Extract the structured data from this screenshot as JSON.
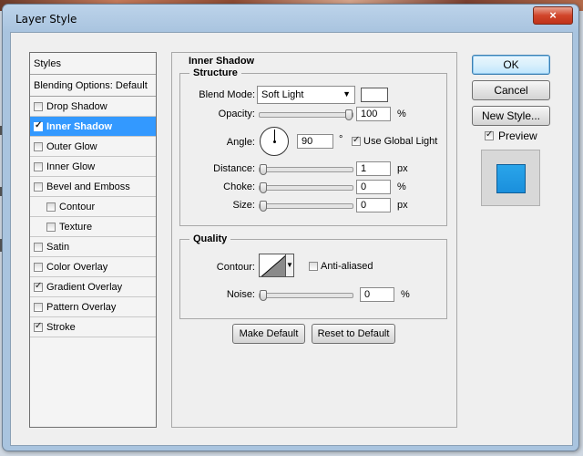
{
  "window": {
    "title": "Layer Style",
    "close_icon": "×"
  },
  "styles": {
    "header": "Styles",
    "blending_options": "Blending Options: Default",
    "items": [
      {
        "label": "Drop Shadow",
        "checked": false,
        "selected": false,
        "indent": false
      },
      {
        "label": "Inner Shadow",
        "checked": true,
        "selected": true,
        "indent": false
      },
      {
        "label": "Outer Glow",
        "checked": false,
        "selected": false,
        "indent": false
      },
      {
        "label": "Inner Glow",
        "checked": false,
        "selected": false,
        "indent": false
      },
      {
        "label": "Bevel and Emboss",
        "checked": false,
        "selected": false,
        "indent": false
      },
      {
        "label": "Contour",
        "checked": false,
        "selected": false,
        "indent": true
      },
      {
        "label": "Texture",
        "checked": false,
        "selected": false,
        "indent": true
      },
      {
        "label": "Satin",
        "checked": false,
        "selected": false,
        "indent": false
      },
      {
        "label": "Color Overlay",
        "checked": false,
        "selected": false,
        "indent": false
      },
      {
        "label": "Gradient Overlay",
        "checked": true,
        "selected": false,
        "indent": false
      },
      {
        "label": "Pattern Overlay",
        "checked": false,
        "selected": false,
        "indent": false
      },
      {
        "label": "Stroke",
        "checked": true,
        "selected": false,
        "indent": false
      }
    ]
  },
  "inner_shadow": {
    "title": "Inner Shadow",
    "structure": {
      "legend": "Structure",
      "blend_mode_label": "Blend Mode:",
      "blend_mode_value": "Soft Light",
      "blend_color": "#ffffff",
      "opacity_label": "Opacity:",
      "opacity_value": "100",
      "opacity_unit": "%",
      "opacity_fraction": 1.0,
      "angle_label": "Angle:",
      "angle_value": "90",
      "angle_unit": "°",
      "use_global_light_label": "Use Global Light",
      "use_global_light_checked": true,
      "distance_label": "Distance:",
      "distance_value": "1",
      "distance_unit": "px",
      "distance_fraction": 0.0,
      "choke_label": "Choke:",
      "choke_value": "0",
      "choke_unit": "%",
      "choke_fraction": 0.0,
      "size_label": "Size:",
      "size_value": "0",
      "size_unit": "px",
      "size_fraction": 0.0
    },
    "quality": {
      "legend": "Quality",
      "contour_label": "Contour:",
      "anti_aliased_label": "Anti-aliased",
      "anti_aliased_checked": false,
      "noise_label": "Noise:",
      "noise_value": "0",
      "noise_unit": "%",
      "noise_fraction": 0.0
    },
    "make_default_label": "Make Default",
    "reset_default_label": "Reset to Default"
  },
  "actions": {
    "ok_label": "OK",
    "cancel_label": "Cancel",
    "new_style_label": "New Style...",
    "preview_label": "Preview",
    "preview_checked": true
  },
  "colors": {
    "selection": "#3399ff",
    "preview_fill": "#1a8fdc"
  }
}
